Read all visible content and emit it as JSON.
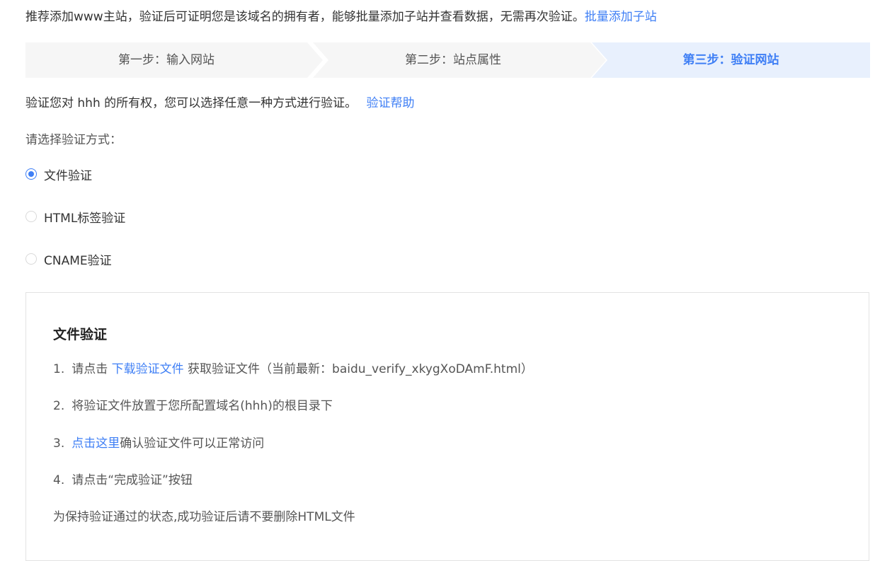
{
  "top_tip": {
    "text": "推荐添加www主站，验证后可证明您是该域名的拥有者，能够批量添加子站并查看数据，无需再次验证。",
    "link": "批量添加子站"
  },
  "steps": [
    {
      "label": "第一步：输入网站",
      "state": "done"
    },
    {
      "label": "第二步：站点属性",
      "state": "done"
    },
    {
      "label": "第三步：验证网站",
      "state": "active"
    }
  ],
  "colors": {
    "accent": "#3f7ff5",
    "step_inactive_bg": "#f6f6f6",
    "step_active_bg": "#e8f0fd"
  },
  "verify_tip": {
    "text": "验证您对 hhh 的所有权，您可以选择任意一种方式进行验证。",
    "link": "验证帮助"
  },
  "choose_label": "请选择验证方式：",
  "methods": [
    {
      "label": "文件验证",
      "checked": true
    },
    {
      "label": "HTML标签验证",
      "checked": false
    },
    {
      "label": "CNAME验证",
      "checked": false
    }
  ],
  "panel": {
    "title": "文件验证",
    "step1": {
      "num": "1.",
      "pre": "请点击",
      "link": "下载验证文件",
      "post": "获取验证文件（当前最新：baidu_verify_xkygXoDAmF.html）"
    },
    "step2": {
      "num": "2.",
      "text": "将验证文件放置于您所配置域名(hhh)的根目录下"
    },
    "step3": {
      "num": "3.",
      "link": "点击这里",
      "post": "确认验证文件可以正常访问"
    },
    "step4": {
      "num": "4.",
      "text": "请点击“完成验证”按钮"
    },
    "note": "为保持验证通过的状态,成功验证后请不要删除HTML文件"
  }
}
